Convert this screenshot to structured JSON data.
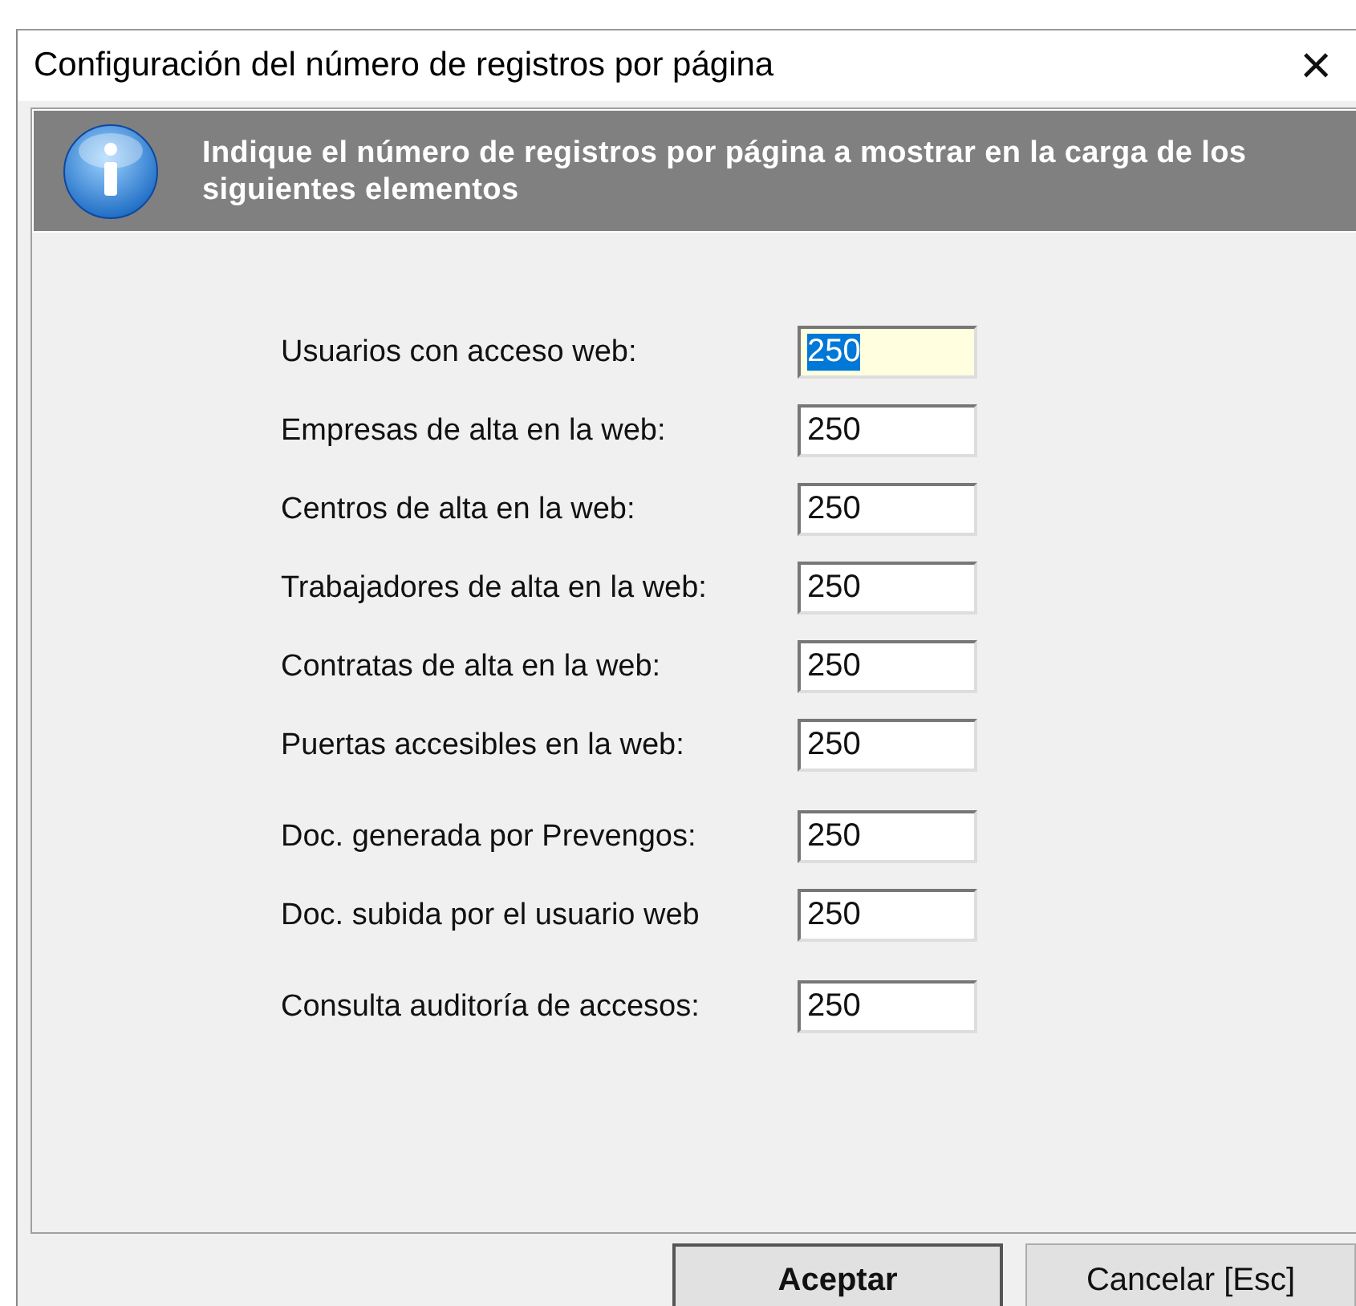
{
  "window": {
    "title": "Configuración del número de registros por página",
    "close": "×"
  },
  "banner": {
    "text": "Indique el número de registros por página a mostrar en la carga de los siguientes elementos"
  },
  "groups": [
    [
      {
        "label": "Usuarios con acceso web:",
        "value": "250",
        "focused": true
      },
      {
        "label": "Empresas de alta en la web:",
        "value": "250",
        "focused": false
      },
      {
        "label": "Centros de alta en la web:",
        "value": "250",
        "focused": false
      },
      {
        "label": "Trabajadores de alta en la web:",
        "value": "250",
        "focused": false
      },
      {
        "label": "Contratas de alta en la web:",
        "value": "250",
        "focused": false
      },
      {
        "label": "Puertas accesibles en la web:",
        "value": "250",
        "focused": false
      }
    ],
    [
      {
        "label": "Doc. generada por Prevengos:",
        "value": "250",
        "focused": false
      },
      {
        "label": "Doc. subida por el usuario web",
        "value": "250",
        "focused": false
      }
    ],
    [
      {
        "label": "Consulta auditoría de accesos:",
        "value": "250",
        "focused": false
      }
    ]
  ],
  "buttons": [
    {
      "label": "Aceptar",
      "default": true
    },
    {
      "label": "Cancelar  [Esc]",
      "default": false
    }
  ]
}
